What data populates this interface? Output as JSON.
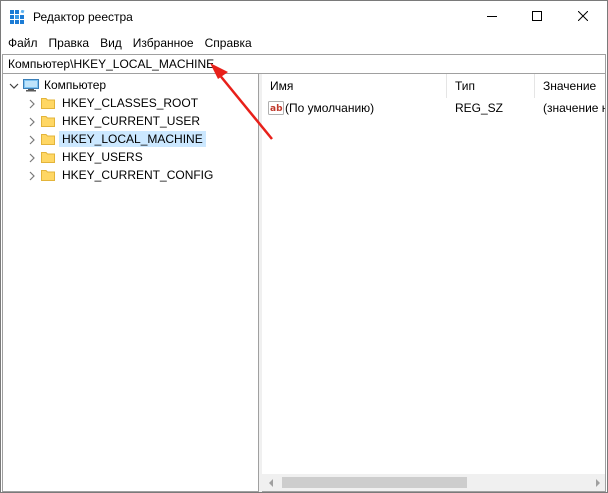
{
  "window": {
    "title": "Редактор реестра",
    "app_icon": "registry-editor-icon",
    "controls": [
      "minimize-icon",
      "maximize-icon",
      "close-icon"
    ]
  },
  "menu": {
    "items": [
      "Файл",
      "Правка",
      "Вид",
      "Избранное",
      "Справка"
    ]
  },
  "address": {
    "value": "Компьютер\\HKEY_LOCAL_MACHINE"
  },
  "tree": {
    "root": {
      "label": "Компьютер",
      "icon": "computer-icon",
      "expanded": true
    },
    "children": [
      {
        "label": "HKEY_CLASSES_ROOT",
        "icon": "folder-icon",
        "selected": false
      },
      {
        "label": "HKEY_CURRENT_USER",
        "icon": "folder-icon",
        "selected": false
      },
      {
        "label": "HKEY_LOCAL_MACHINE",
        "icon": "folder-icon",
        "selected": true
      },
      {
        "label": "HKEY_USERS",
        "icon": "folder-icon",
        "selected": false
      },
      {
        "label": "HKEY_CURRENT_CONFIG",
        "icon": "folder-icon",
        "selected": false
      }
    ]
  },
  "list": {
    "columns": [
      "Имя",
      "Тип",
      "Значение"
    ],
    "rows": [
      {
        "name": "(По умолчанию)",
        "type": "REG_SZ",
        "value": "(значение н",
        "icon": "string-value-icon"
      }
    ]
  },
  "colors": {
    "selection": "#cce8ff",
    "annotation_arrow": "#e8201a",
    "folder": "#ffd764"
  }
}
